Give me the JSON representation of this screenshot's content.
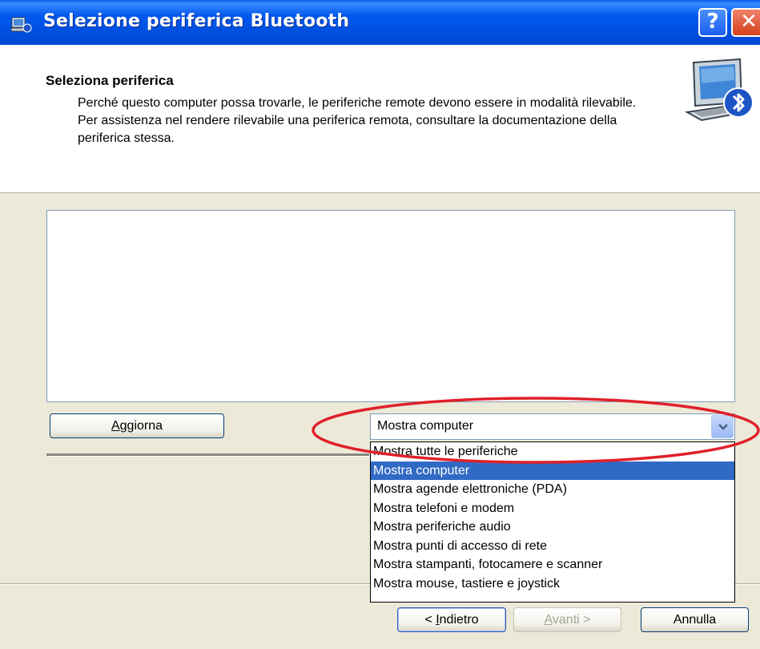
{
  "window": {
    "title": "Selezione periferica Bluetooth",
    "help_label": "?",
    "close_label": "✕",
    "title_icon": "bluetooth-computer-icon"
  },
  "header": {
    "title": "Seleziona periferica",
    "line1": "Perché questo computer possa trovarle, le periferiche remote devono essere in modalità rilevabile.",
    "line2": "Per assistenza nel rendere rilevabile una periferica remota, consultare la documentazione della periferica stessa.",
    "icon": "bluetooth-computer-icon"
  },
  "device_list": {
    "items": []
  },
  "refresh_button": {
    "prefix": "A",
    "rest": "ggiorna"
  },
  "filter": {
    "selected": "Mostra computer",
    "options": [
      "Mostra tutte le periferiche",
      "Mostra computer",
      "Mostra agende elettroniche (PDA)",
      "Mostra telefoni e modem",
      "Mostra periferiche audio",
      "Mostra punti di accesso di rete",
      "Mostra stampanti, fotocamere e scanner",
      "Mostra mouse, tastiere e joystick"
    ],
    "selected_index": 1
  },
  "footer": {
    "back": {
      "pre": "< ",
      "key": "I",
      "rest": "ndietro"
    },
    "next": {
      "key": "A",
      "rest": "vanti >"
    },
    "cancel": "Annulla"
  },
  "colors": {
    "highlight": "#e0202a",
    "selection": "#316ac5",
    "titlebar": "#0058ee"
  }
}
